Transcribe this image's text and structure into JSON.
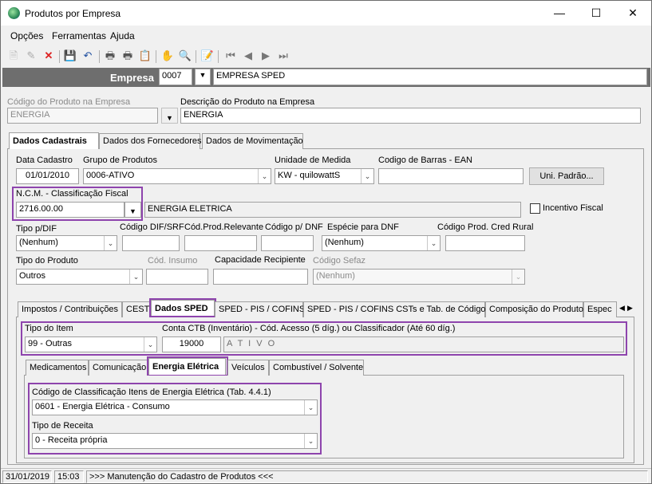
{
  "window": {
    "title": "Produtos por Empresa"
  },
  "menu": [
    "Opções",
    "Ferramentas",
    "Ajuda"
  ],
  "empresa": {
    "label": "Empresa",
    "code": "0007",
    "name": "EMPRESA SPED"
  },
  "produto": {
    "codigo_label": "Código do Produto na Empresa",
    "codigo_value": "ENERGIA",
    "descricao_label": "Descrição do Produto na Empresa",
    "descricao_value": "ENERGIA"
  },
  "main_tabs": [
    "Dados Cadastrais",
    "Dados dos Fornecedores",
    "Dados de Movimentação"
  ],
  "cadastro": {
    "data_cadastro_label": "Data Cadastro",
    "data_cadastro": "01/01/2010",
    "grupo_label": "Grupo de Produtos",
    "grupo": "0006-ATIVO",
    "unidade_label": "Unidade de Medida",
    "unidade": "KW - quilowattS",
    "ean_label": "Codigo de Barras - EAN",
    "ean": "",
    "uni_padrao_button": "Uni. Padrão...",
    "ncm_label": "N.C.M. -  Classificação Fiscal",
    "ncm": "2716.00.00",
    "ncm_desc": "ENERGIA ELETRICA",
    "incentivo_label": "Incentivo Fiscal",
    "tipo_dif_label": "Tipo p/DIF",
    "tipo_dif": "(Nenhum)",
    "cod_dif_label": "Código DIF/SRF",
    "cod_relevante_label": "Cód.Prod.Relevante",
    "cod_dnf_label": "Código p/ DNF",
    "especie_dnf_label": "Espécie para DNF",
    "especie_dnf": "(Nenhum)",
    "cred_rural_label": "Código Prod. Cred Rural",
    "tipo_produto_label": "Tipo do Produto",
    "tipo_produto": "Outros",
    "cod_insumo_label": "Cód. Insumo",
    "capacidade_label": "Capacidade Recipiente",
    "cod_sefaz_label": "Código Sefaz",
    "cod_sefaz": "(Nenhum)"
  },
  "sub_tabs": [
    "Impostos / Contribuições",
    "CEST",
    "Dados SPED",
    "SPED - PIS / COFINS",
    "SPED - PIS / COFINS CSTs e Tab. de Códigos",
    "Composição do Produto",
    "Espec"
  ],
  "sped": {
    "tipo_item_label": "Tipo do Item",
    "tipo_item": "99 - Outras",
    "conta_label": "Conta CTB (Inventário) - Cód. Acesso (5 díg.) ou Classificador (Até 60 díg.)",
    "conta_code": "19000",
    "conta_desc": "A T I V O"
  },
  "inner_tabs": [
    "Medicamentos",
    "Comunicação",
    "Energia Elétrica",
    "Veículos",
    "Combustível / Solvente"
  ],
  "energia": {
    "classif_label": "Código de Classificação Itens de Energia Elétrica (Tab. 4.4.1)",
    "classif": "0601 - Energia Elétrica - Consumo",
    "receita_label": "Tipo de Receita",
    "receita": "0 - Receita própria"
  },
  "status": {
    "date": "31/01/2019",
    "time": "15:03",
    "message": ">>> Manutenção do Cadastro de Produtos <<<"
  },
  "colors": {
    "highlight": "#8e44ad",
    "empresa_bar": "#6e6e6e"
  }
}
